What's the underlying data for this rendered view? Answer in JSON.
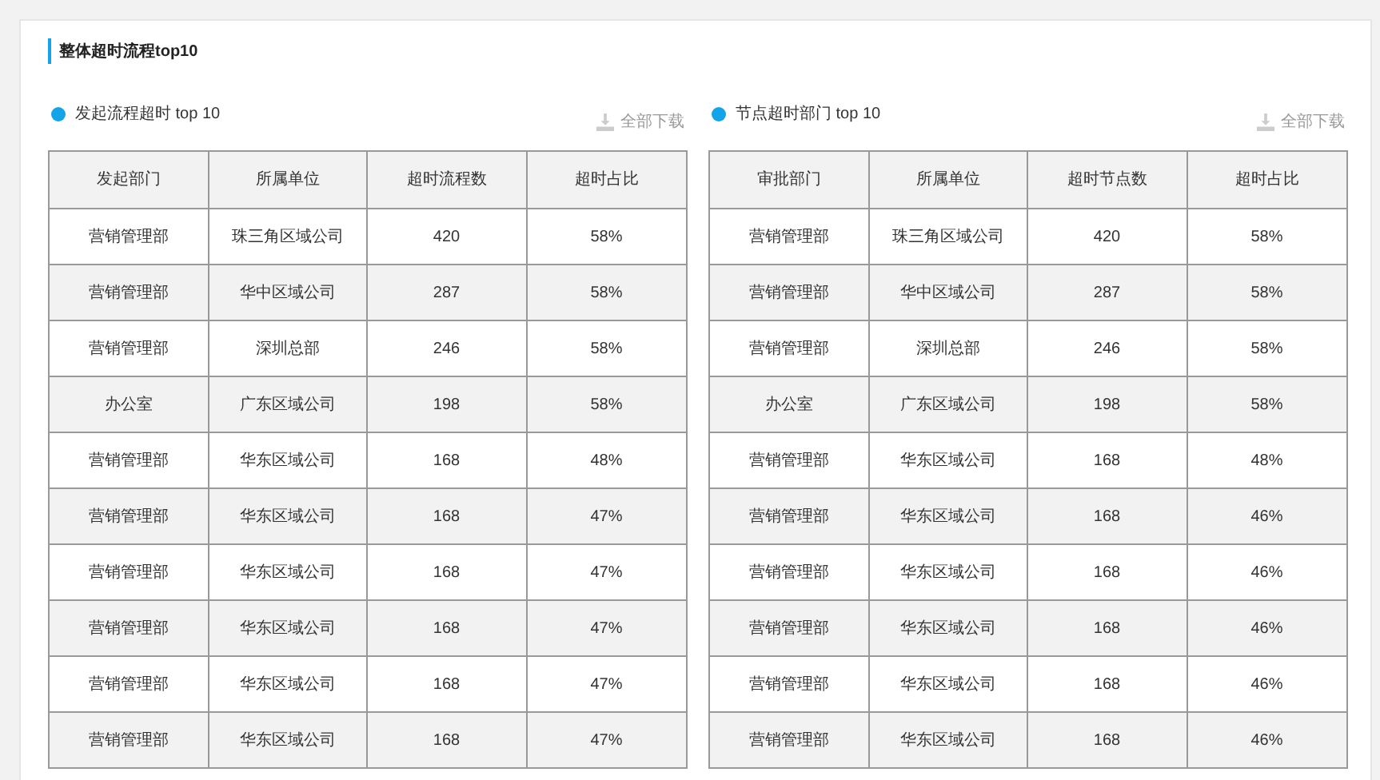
{
  "title": "整体超时流程top10",
  "panels": [
    {
      "heading": "发起流程超时 top 10",
      "download": "全部下载",
      "columns": [
        "发起部门",
        "所属单位",
        "超时流程数",
        "超时占比"
      ],
      "rows": [
        [
          "营销管理部",
          "珠三角区域公司",
          "420",
          "58%"
        ],
        [
          "营销管理部",
          "华中区域公司",
          "287",
          "58%"
        ],
        [
          "营销管理部",
          "深圳总部",
          "246",
          "58%"
        ],
        [
          "办公室",
          "广东区域公司",
          "198",
          "58%"
        ],
        [
          "营销管理部",
          "华东区域公司",
          "168",
          "48%"
        ],
        [
          "营销管理部",
          "华东区域公司",
          "168",
          "47%"
        ],
        [
          "营销管理部",
          "华东区域公司",
          "168",
          "47%"
        ],
        [
          "营销管理部",
          "华东区域公司",
          "168",
          "47%"
        ],
        [
          "营销管理部",
          "华东区域公司",
          "168",
          "47%"
        ],
        [
          "营销管理部",
          "华东区域公司",
          "168",
          "47%"
        ]
      ]
    },
    {
      "heading": "节点超时部门 top 10",
      "download": "全部下载",
      "columns": [
        "审批部门",
        "所属单位",
        "超时节点数",
        "超时占比"
      ],
      "rows": [
        [
          "营销管理部",
          "珠三角区域公司",
          "420",
          "58%"
        ],
        [
          "营销管理部",
          "华中区域公司",
          "287",
          "58%"
        ],
        [
          "营销管理部",
          "深圳总部",
          "246",
          "58%"
        ],
        [
          "办公室",
          "广东区域公司",
          "198",
          "58%"
        ],
        [
          "营销管理部",
          "华东区域公司",
          "168",
          "48%"
        ],
        [
          "营销管理部",
          "华东区域公司",
          "168",
          "46%"
        ],
        [
          "营销管理部",
          "华东区域公司",
          "168",
          "46%"
        ],
        [
          "营销管理部",
          "华东区域公司",
          "168",
          "46%"
        ],
        [
          "营销管理部",
          "华东区域公司",
          "168",
          "46%"
        ],
        [
          "营销管理部",
          "华东区域公司",
          "168",
          "46%"
        ]
      ]
    }
  ]
}
